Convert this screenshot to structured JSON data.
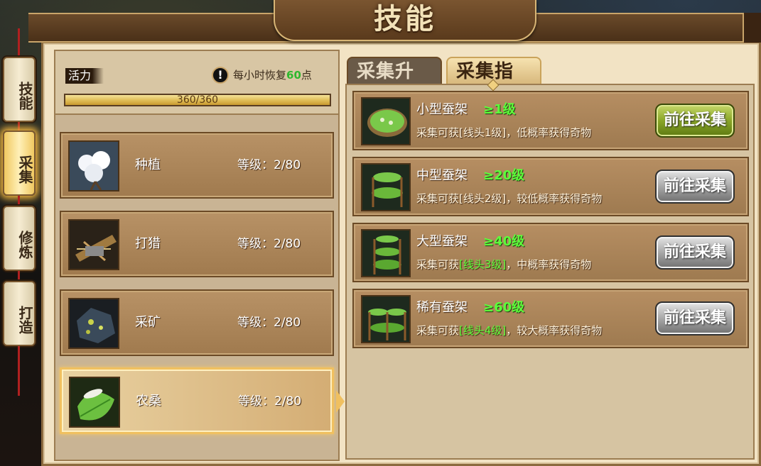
{
  "window": {
    "title": "技能"
  },
  "side_tabs": [
    {
      "label": "技能",
      "active": false
    },
    {
      "label": "采集",
      "active": true
    },
    {
      "label": "修炼",
      "active": false
    },
    {
      "label": "打造",
      "active": false
    }
  ],
  "vitality": {
    "label": "活力",
    "recover_prefix": "每小时恢复",
    "recover_value": "60",
    "recover_suffix": "点",
    "bar_text": "360/360",
    "current": 360,
    "max": 360
  },
  "skills": [
    {
      "name": "种植",
      "level": "等级：2/80",
      "icon": "cotton-icon",
      "selected": false
    },
    {
      "name": "打猎",
      "level": "等级：2/80",
      "icon": "hunting-trap-icon",
      "selected": false
    },
    {
      "name": "采矿",
      "level": "等级：2/80",
      "icon": "ore-icon",
      "selected": false
    },
    {
      "name": "农桑",
      "level": "等级：2/80",
      "icon": "silkworm-leaf-icon",
      "selected": true
    }
  ],
  "tabs": [
    {
      "label": "采集升级",
      "active": false
    },
    {
      "label": "采集指南",
      "active": true
    }
  ],
  "guides": [
    {
      "title": "小型蚕架",
      "req": "≥1级",
      "desc_prefix": "采集可获",
      "desc_item": "[线头1级]",
      "desc_suffix": "，低概率获得奇物",
      "item_green": false,
      "button": "前往采集",
      "button_style": "green",
      "icon": "small-silk-rack-icon"
    },
    {
      "title": "中型蚕架",
      "req": "≥20级",
      "desc_prefix": "采集可获",
      "desc_item": "[线头2级]",
      "desc_suffix": "，较低概率获得奇物",
      "item_green": false,
      "button": "前往采集",
      "button_style": "grey",
      "icon": "medium-silk-rack-icon"
    },
    {
      "title": "大型蚕架",
      "req": "≥40级",
      "desc_prefix": "采集可获",
      "desc_item": "[线头3级]",
      "desc_suffix": "，中概率获得奇物",
      "item_green": true,
      "button": "前往采集",
      "button_style": "grey",
      "icon": "large-silk-rack-icon"
    },
    {
      "title": "稀有蚕架",
      "req": "≥60级",
      "desc_prefix": "采集可获",
      "desc_item": "[线头4级]",
      "desc_suffix": "，较大概率获得奇物",
      "item_green": true,
      "button": "前往采集",
      "button_style": "grey",
      "icon": "rare-silk-rack-icon"
    }
  ],
  "colors": {
    "accent_green": "#5cff3a",
    "selected_border": "#f0c060",
    "recover_highlight": "#2eb82e"
  }
}
